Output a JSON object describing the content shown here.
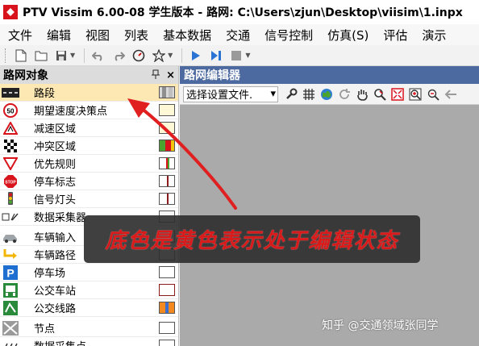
{
  "window": {
    "title": "PTV Vissim 6.00-08 学生版本 - 路网: C:\\Users\\zjun\\Desktop\\viisim\\1.inpx"
  },
  "menu": [
    "文件",
    "编辑",
    "视图",
    "列表",
    "基本数据",
    "交通",
    "信号控制",
    "仿真(S)",
    "评估",
    "演示"
  ],
  "left_panel": {
    "title": "路网对象",
    "pin_glyph": "📌",
    "close_glyph": "×",
    "items": [
      {
        "label": "路段",
        "icon": "road-icon",
        "selected": true,
        "swatch": "gray-stripes"
      },
      {
        "label": "期望速度决策点",
        "icon": "speed-50-icon",
        "selected": false,
        "swatch": "light-yellow"
      },
      {
        "label": "减速区域",
        "icon": "warning-triangle-icon",
        "selected": false,
        "swatch": "light-yellow"
      },
      {
        "label": "冲突区域",
        "icon": "checkered-flag-icon",
        "selected": false,
        "swatch": "traffic-colors"
      },
      {
        "label": "优先规则",
        "icon": "yield-icon",
        "selected": false,
        "swatch": "red-green-line"
      },
      {
        "label": "停车标志",
        "icon": "stop-sign-icon",
        "selected": false,
        "swatch": "red-line"
      },
      {
        "label": "信号灯头",
        "icon": "traffic-light-icon",
        "selected": false,
        "swatch": "red-line"
      },
      {
        "label": "数据采集器",
        "icon": "data-collector-icon",
        "selected": false,
        "swatch": "white"
      },
      {
        "label": "车辆输入",
        "icon": "vehicle-icon",
        "selected": false,
        "swatch": "white"
      },
      {
        "label": "车辆路径",
        "icon": "route-icon",
        "selected": false,
        "swatch": "white"
      },
      {
        "label": "停车场",
        "icon": "parking-icon",
        "selected": false,
        "swatch": "white"
      },
      {
        "label": "公交车站",
        "icon": "bus-stop-icon",
        "selected": false,
        "swatch": "dark-red-border"
      },
      {
        "label": "公交线路",
        "icon": "transit-line-icon",
        "selected": false,
        "swatch": "orange"
      },
      {
        "label": "节点",
        "icon": "node-icon",
        "selected": false,
        "swatch": "white"
      },
      {
        "label": "数据采集点",
        "icon": "data-point-icon",
        "selected": false,
        "swatch": "white"
      }
    ]
  },
  "network_editor": {
    "title": "路网编辑器",
    "select_value": "选择设置文件.",
    "dropdown_glyph": "▾"
  },
  "annotation": {
    "text": "底色是黄色表示处于编辑状态",
    "color": "#d91a1a"
  },
  "watermark": "知乎 @交通领域张同学",
  "colors": {
    "selected_row": "#fde8b4",
    "editor_header": "#4d6aa0",
    "editor_canvas": "#aaaaaa",
    "arrow": "#e02020"
  }
}
